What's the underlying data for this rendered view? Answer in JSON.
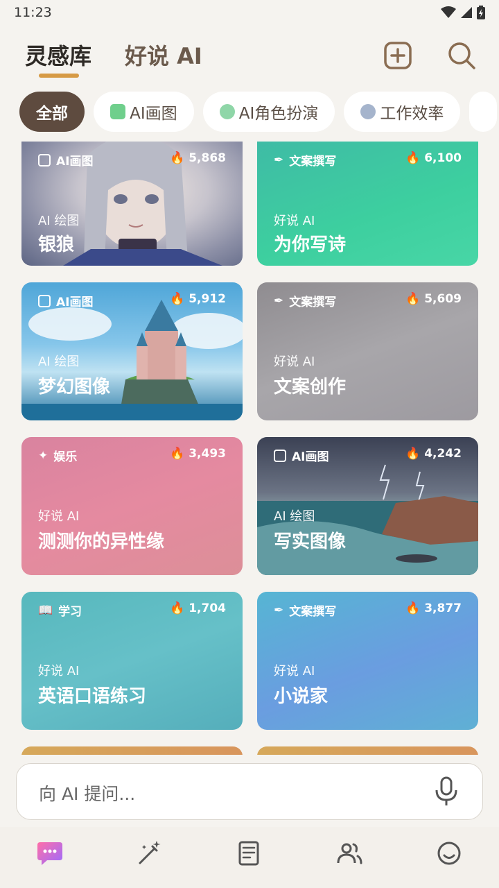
{
  "status": {
    "time": "11:23"
  },
  "header": {
    "tabs": [
      "灵感库",
      "好说 AI"
    ]
  },
  "chips": [
    "全部",
    "AI画图",
    "AI角色扮演",
    "工作效率"
  ],
  "cards": [
    {
      "category": "AI画图",
      "count": "5,868",
      "subtitle": "AI 绘图",
      "title": "银狼"
    },
    {
      "category": "文案撰写",
      "count": "6,100",
      "subtitle": "好说 AI",
      "title": "为你写诗"
    },
    {
      "category": "AI画图",
      "count": "5,912",
      "subtitle": "AI 绘图",
      "title": "梦幻图像"
    },
    {
      "category": "文案撰写",
      "count": "5,609",
      "subtitle": "好说 AI",
      "title": "文案创作"
    },
    {
      "category": "娱乐",
      "count": "3,493",
      "subtitle": "好说 AI",
      "title": "测测你的异性缘"
    },
    {
      "category": "AI画图",
      "count": "4,242",
      "subtitle": "AI 绘图",
      "title": "写实图像"
    },
    {
      "category": "学习",
      "count": "1,704",
      "subtitle": "好说 AI",
      "title": "英语口语练习"
    },
    {
      "category": "文案撰写",
      "count": "3,877",
      "subtitle": "好说 AI",
      "title": "小说家"
    }
  ],
  "input": {
    "placeholder": "向 AI 提问..."
  },
  "colors": {
    "accent": "#d69a45",
    "active_chip": "#5e4b3f",
    "nav_active": "#e84a8a"
  }
}
